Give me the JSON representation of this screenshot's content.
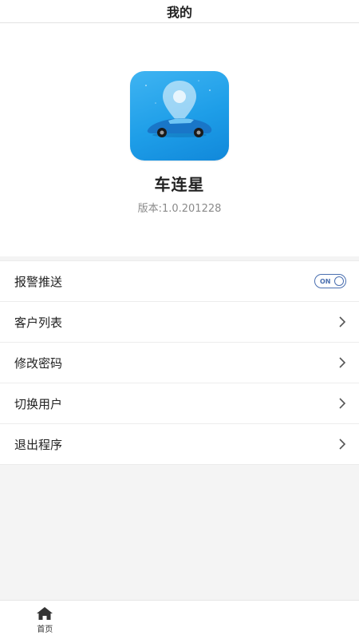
{
  "header": {
    "title": "我的"
  },
  "app": {
    "name": "车连星",
    "version": "版本:1.0.201228",
    "icon": "car-location-pin-icon",
    "icon_colors": {
      "bg_top": "#3fb4f2",
      "bg_bottom": "#1188da",
      "car": "#1976c8"
    }
  },
  "menu": {
    "items": [
      {
        "label": "报警推送",
        "control": "toggle",
        "toggle_text": "ON",
        "toggle_state": true
      },
      {
        "label": "客户列表",
        "control": "chevron"
      },
      {
        "label": "修改密码",
        "control": "chevron"
      },
      {
        "label": "切换用户",
        "control": "chevron"
      },
      {
        "label": "退出程序",
        "control": "chevron"
      }
    ]
  },
  "bottom_nav": {
    "tabs": [
      {
        "label": "首页",
        "icon": "home-icon"
      }
    ]
  },
  "colors": {
    "accent": "#4a6fb0",
    "background": "#f4f4f4"
  }
}
